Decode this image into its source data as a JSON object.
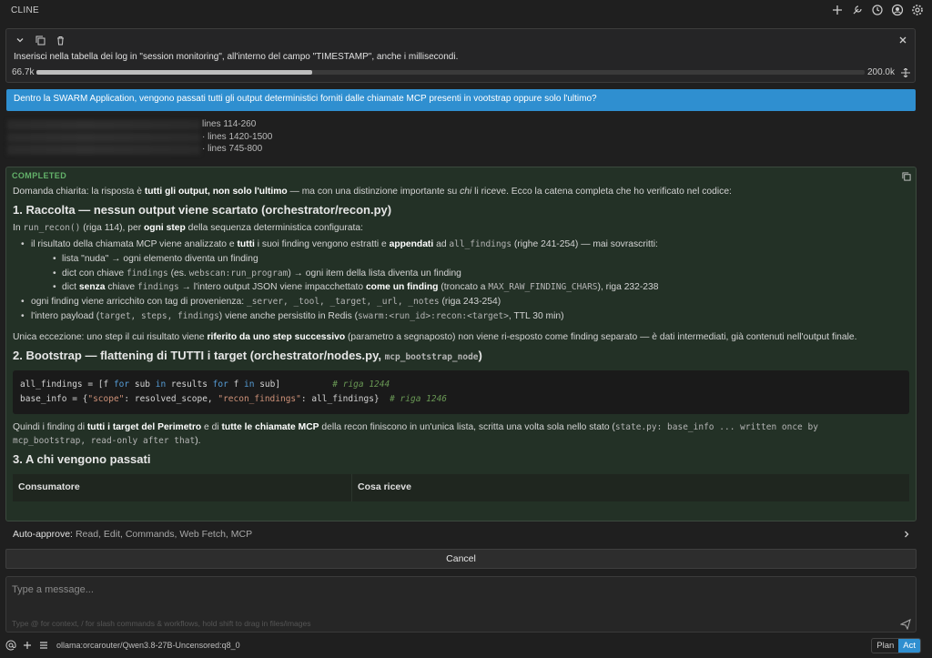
{
  "app": {
    "title": "CLINE"
  },
  "header_icons": [
    "plus-icon",
    "mcp-icon",
    "history-icon",
    "account-icon",
    "settings-icon"
  ],
  "task": {
    "text": "Inserisci nella tabella dei log in \"session monitoring\", all'interno del campo \"TIMESTAMP\", anche i millisecondi.",
    "context_used": "66.7k",
    "context_max": "200.0k",
    "context_fraction": 0.333
  },
  "user_message": "Dentro la SWARM Application, vengono passati tutti gli output deterministici forniti dalle chiamate MCP presenti in vootstrap oppure solo l'ultimo?",
  "files": [
    {
      "lines": "lines 114-260"
    },
    {
      "lines": "· lines 1420-1500"
    },
    {
      "lines": "· lines 745-800"
    }
  ],
  "completed": {
    "label": "COMPLETED",
    "intro": {
      "a": "Domanda chiarita: la risposta è ",
      "b": "tutti gli output, non solo l'ultimo",
      "c": " — ma con una distinzione importante su ",
      "d": "chi",
      "e": " li riceve. Ecco la catena completa che ho verificato nel codice:"
    },
    "s1": {
      "title": "1. Raccolta — nessun output viene scartato (orchestrator/recon.py)",
      "p": {
        "a": "In ",
        "code": "run_recon()",
        "b": " (riga 114), per ",
        "c": "ogni step",
        "d": " della sequenza deterministica configurata:"
      },
      "b1": {
        "a": "il risultato della chiamata MCP viene analizzato e ",
        "b": "tutti",
        "c": " i suoi finding vengono estratti e ",
        "d": "appendati",
        "e": " ad ",
        "code": "all_findings",
        "f": " (righe 241-254) — mai sovrascritti:"
      },
      "sub1": "lista \"nuda\" → ogni elemento diventa un finding",
      "sub2": {
        "a": "dict con chiave ",
        "code1": "findings",
        "b": " (es. ",
        "code2": "webscan:run_program",
        "c": ") → ogni item della lista diventa un finding"
      },
      "sub3": {
        "a": "dict ",
        "b": "senza",
        "c": " chiave ",
        "code1": "findings",
        "d": " → l'intero output JSON viene impacchettato ",
        "e": "come un finding",
        "f": " (troncato a ",
        "code2": "MAX_RAW_FINDING_CHARS",
        "g": "), riga 232-238"
      },
      "b2": {
        "a": "ogni finding viene arricchito con tag di provenienza: ",
        "code": "_server, _tool, _target, _url, _notes",
        "b": " (riga 243-254)"
      },
      "b3": {
        "a": "l'intero payload (",
        "code1": "target, steps, findings",
        "b": ") viene anche persistito in Redis (",
        "code2": "swarm:<run_id>:recon:<target>",
        "c": ", TTL 30 min)"
      },
      "exception": {
        "a": "Unica eccezione: uno step il cui risultato viene ",
        "b": "riferito da uno step successivo",
        "c": " (parametro a segnaposto) non viene ri-esposto come finding separato — è dati intermediati, già contenuti nell'output finale."
      }
    },
    "s2": {
      "title": "2. Bootstrap — flattening di TUTTI i target (orchestrator/nodes.py, ",
      "title_code": "mcp_bootstrap_node",
      "title_end": ")",
      "code_line1": {
        "a": "all_findings = [f ",
        "kw1": "for",
        "b": " sub ",
        "kw2": "in",
        "c": " results ",
        "kw3": "for",
        "d": " f ",
        "kw4": "in",
        "e": " sub]",
        "cmt": "# riga 1244"
      },
      "code_line2": {
        "a": "base_info = {",
        "s1": "\"scope\"",
        "b": ": resolved_scope, ",
        "s2": "\"recon_findings\"",
        "c": ": all_findings}  ",
        "cmt": "# riga 1246"
      },
      "p": {
        "a": "Quindi i finding di ",
        "b": "tutti i target del Perimetro",
        "c": " e di ",
        "d": "tutte le chiamate MCP",
        "e": " della recon finiscono in un'unica lista, scritta una volta sola nello stato (",
        "code1": "state.py: base_info ... written once by",
        "code2": "mcp_bootstrap, read-only after that",
        "f": ")."
      }
    },
    "s3": {
      "title": "3. A chi vengono passati",
      "columns": [
        "Consumatore",
        "Cosa riceve"
      ]
    }
  },
  "auto_approve": {
    "label": "Auto-approve:",
    "values": "Read, Edit, Commands, Web Fetch, MCP"
  },
  "cancel_label": "Cancel",
  "input": {
    "placeholder": "Type a message...",
    "hint": "Type @ for context, / for slash commands & workflows, hold shift to drag in files/images"
  },
  "bottom": {
    "model": "ollama:orcarouter/Qwen3.8-27B-Uncensored:q8_0",
    "modes": [
      "Plan",
      "Act"
    ],
    "active_mode": "Act"
  },
  "colors": {
    "accent": "#2f8fd0",
    "completed_bg": "#233126",
    "completed_label": "#63b26a"
  }
}
